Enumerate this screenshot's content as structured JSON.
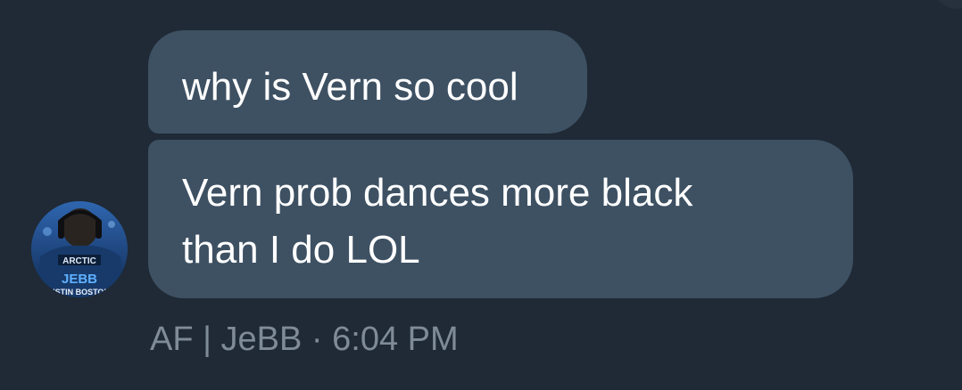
{
  "messages": [
    {
      "text": "why is Vern so cool"
    },
    {
      "lines": [
        "Vern prob dances more black",
        "than I do LOL"
      ]
    }
  ],
  "sender": {
    "name": "AF | JeBB",
    "separator": " · ",
    "time": "6:04 PM"
  },
  "avatar": {
    "jersey_brand": "ARCTIC",
    "jersey_name": "JEBB",
    "jersey_team": "USTIN BOSTON"
  },
  "colors": {
    "background": "#1f2a36",
    "bubble": "#3e5163",
    "meta_text": "#7f8b96"
  }
}
